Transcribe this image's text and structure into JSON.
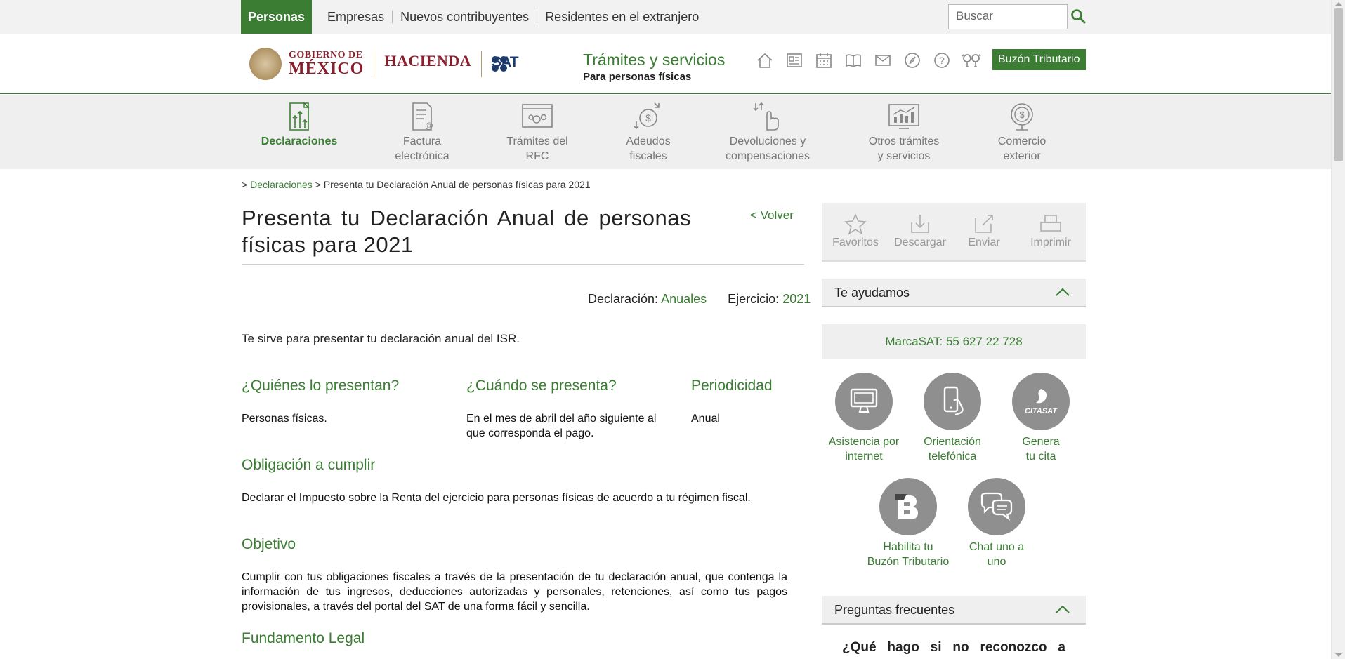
{
  "topnav": {
    "tabs": [
      "Personas",
      "Empresas",
      "Nuevos contribuyentes",
      "Residentes en el extranjero"
    ],
    "search_placeholder": "Buscar"
  },
  "header": {
    "logo_gob_l1": "GOBIERNO DE",
    "logo_gob_l2": "MÉXICO",
    "logo_hacienda": "HACIENDA",
    "logo_sat": "SAT",
    "tramites_title": "Trámites y servicios",
    "tramites_sub": "Para personas físicas",
    "icons": [
      "home-icon",
      "news-icon",
      "calendar-icon",
      "book-icon",
      "mail-icon",
      "compass-icon",
      "help-icon",
      "accessibility-icon"
    ],
    "buzon_button": "Buzón Tributario"
  },
  "categories": [
    {
      "l1": "Declaraciones",
      "l2": "",
      "icon": "declaraciones-icon"
    },
    {
      "l1": "Factura",
      "l2": "electrónica",
      "icon": "factura-icon"
    },
    {
      "l1": "Trámites del",
      "l2": "RFC",
      "icon": "rfc-icon"
    },
    {
      "l1": "Adeudos",
      "l2": "fiscales",
      "icon": "adeudos-icon"
    },
    {
      "l1": "Devoluciones y",
      "l2": "compensaciones",
      "icon": "devoluciones-icon"
    },
    {
      "l1": "Otros trámites",
      "l2": "y servicios",
      "icon": "otros-icon"
    },
    {
      "l1": "Comercio",
      "l2": "exterior",
      "icon": "comercio-icon"
    }
  ],
  "breadcrumb": {
    "prefix": ">",
    "link": "Declaraciones",
    "sep": ">",
    "current": "Presenta tu Declaración Anual de personas físicas para 2021"
  },
  "main": {
    "title": "Presenta tu Declaración Anual de personas físicas para 2021",
    "volver": "< Volver",
    "declaracion_label": "Declaración:",
    "declaracion_value": "Anuales",
    "ejercicio_label": "Ejercicio:",
    "ejercicio_value": "2021",
    "lead": "Te sirve para presentar tu declaración anual del ISR.",
    "quienes_h": "¿Quiénes lo presentan?",
    "quienes_t": "Personas físicas.",
    "cuando_h": "¿Cuándo se presenta?",
    "cuando_t": "En el mes de abril del año siguiente al que corresponda el pago.",
    "periodicidad_h": "Periodicidad",
    "periodicidad_t": "Anual",
    "obligacion_h": "Obligación a cumplir",
    "obligacion_t": "Declarar el Impuesto sobre la Renta del ejercicio para personas físicas de acuerdo a tu régimen fiscal.",
    "objetivo_h": "Objetivo",
    "objetivo_t": "Cumplir con tus obligaciones fiscales a través de la presentación de tu declaración anual, que contenga la información de tus ingresos, deducciones autorizadas y personales, retenciones, así como tus pagos provisionales, a través del portal del SAT de una forma fácil y sencilla.",
    "fundamento_h": "Fundamento Legal"
  },
  "sidebar": {
    "actions": [
      "Favoritos",
      "Descargar",
      "Enviar",
      "Imprimir"
    ],
    "te_ayudamos": "Te ayudamos",
    "marcasat": "MarcaSAT: 55 627 22 728",
    "help": [
      {
        "l1": "Asistencia por",
        "l2": "internet"
      },
      {
        "l1": "Orientación",
        "l2": "telefónica"
      },
      {
        "l1": "Genera",
        "l2": "tu cita"
      },
      {
        "l1": "Habilita tu",
        "l2": "Buzón Tributario"
      },
      {
        "l1": "Chat uno a",
        "l2": "uno"
      }
    ],
    "citasat_label": "CITASAT",
    "preguntas": "Preguntas frecuentes",
    "faq_words": [
      "¿Qué",
      "hago",
      "si",
      "no",
      "reconozco",
      "a"
    ]
  },
  "colors": {
    "accent": "#3a7d33",
    "brand_red": "#8b1e2c",
    "sat_blue": "#1d3a6d"
  }
}
